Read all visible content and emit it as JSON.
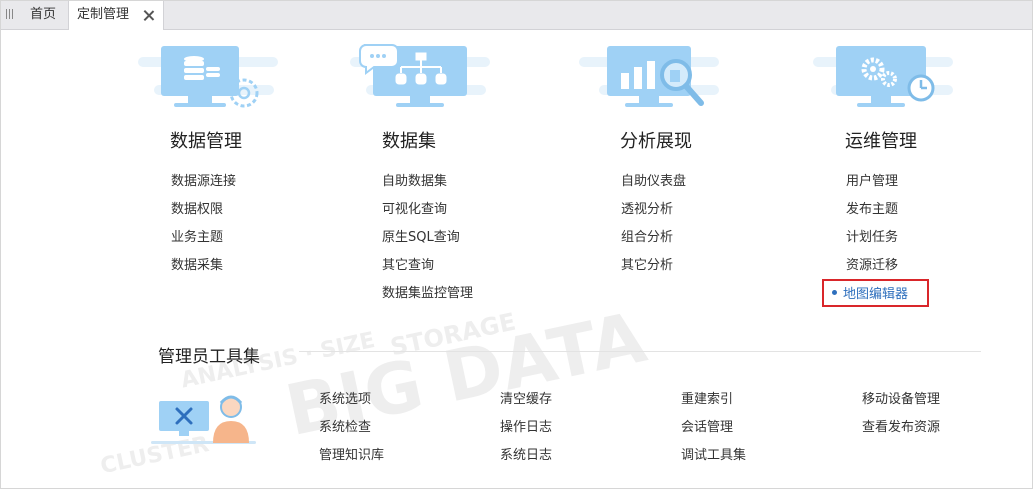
{
  "tabs": [
    {
      "label": "首页",
      "active": false
    },
    {
      "label": "定制管理",
      "active": true
    }
  ],
  "categories": [
    {
      "title": "数据管理",
      "illustration": "database-settings-monitor-icon",
      "items": [
        "数据源连接",
        "数据权限",
        "业务主题",
        "数据采集"
      ]
    },
    {
      "title": "数据集",
      "illustration": "dataset-chat-monitor-icon",
      "items": [
        "自助数据集",
        "可视化查询",
        "原生SQL查询",
        "其它查询",
        "数据集监控管理"
      ]
    },
    {
      "title": "分析展现",
      "illustration": "bar-chart-magnifier-monitor-icon",
      "items": [
        "自助仪表盘",
        "透视分析",
        "组合分析",
        "其它分析"
      ]
    },
    {
      "title": "运维管理",
      "illustration": "gears-clock-monitor-icon",
      "items": [
        "用户管理",
        "发布主题",
        "计划任务",
        "资源迁移",
        "地图编辑器"
      ],
      "highlighted_item": "地图编辑器"
    }
  ],
  "admin": {
    "title": "管理员工具集",
    "illustration": "admin-tools-person-icon",
    "columns": [
      [
        "系统选项",
        "系统检查",
        "管理知识库"
      ],
      [
        "清空缓存",
        "操作日志",
        "系统日志"
      ],
      [
        "重建索引",
        "会话管理",
        "调试工具集"
      ],
      [
        "移动设备管理",
        "查看发布资源"
      ]
    ]
  },
  "colors": {
    "accent_blue": "#2e6fbd",
    "illustration_blue": "#9fd1f5",
    "highlight_border": "#d9262a",
    "tabbar_bg": "#e9e9ec"
  }
}
